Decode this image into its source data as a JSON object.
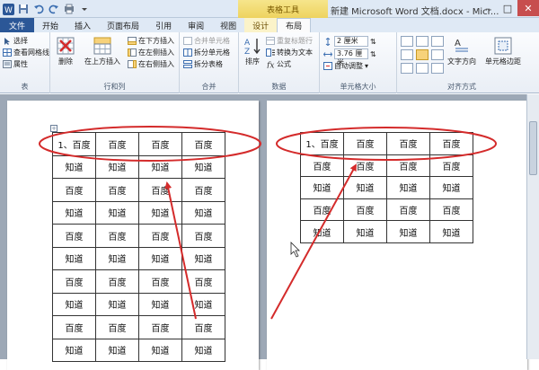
{
  "window": {
    "context_tab_group": "表格工具",
    "document_title": "新建 Microsoft Word 文档.docx - Micr...",
    "minimize": "–",
    "maximize": "□",
    "close": "✕"
  },
  "tabs": [
    {
      "label": "文件"
    },
    {
      "label": "开始"
    },
    {
      "label": "插入"
    },
    {
      "label": "页面布局"
    },
    {
      "label": "引用"
    },
    {
      "label": "审阅"
    },
    {
      "label": "视图"
    },
    {
      "label": "设计"
    },
    {
      "label": "布局"
    }
  ],
  "ribbon": {
    "table_group": {
      "label": "表",
      "select": "选择",
      "gridlines": "查看网格线",
      "properties": "属性"
    },
    "rows_cols_group": {
      "label": "行和列",
      "delete": "删除",
      "insert_above": "在上方插入",
      "insert_below": "在下方插入",
      "insert_left": "在左侧插入",
      "insert_right": "在右侧插入"
    },
    "merge_group": {
      "label": "合并",
      "merge_cells": "合并单元格",
      "split_cells": "拆分单元格",
      "split_table": "拆分表格"
    },
    "data_group": {
      "label": "数据",
      "sort": "排序",
      "repeat_header": "重复标题行",
      "to_text": "转换为文本",
      "formula": "公式"
    },
    "cell_size_group": {
      "label": "单元格大小",
      "height": "2 厘米",
      "width": "3.76 厘米",
      "autofit": "自动调整"
    },
    "alignment_group": {
      "label": "对齐方式",
      "text_direction": "文字方向",
      "cell_margins": "单元格边距"
    }
  },
  "left_table": [
    [
      "1、百度",
      "百度",
      "百度",
      "百度"
    ],
    [
      "知道",
      "知道",
      "知道",
      "知道"
    ],
    [
      "百度",
      "百度",
      "百度",
      "百度"
    ],
    [
      "知道",
      "知道",
      "知道",
      "知道"
    ],
    [
      "百度",
      "百度",
      "百度",
      "百度"
    ],
    [
      "知道",
      "知道",
      "知道",
      "知道"
    ],
    [
      "百度",
      "百度",
      "百度",
      "百度"
    ],
    [
      "知道",
      "知道",
      "知道",
      "知道"
    ],
    [
      "百度",
      "百度",
      "百度",
      "百度"
    ],
    [
      "知道",
      "知道",
      "知道",
      "知道"
    ]
  ],
  "right_table": [
    [
      "1、百度",
      "百度",
      "百度",
      "百度"
    ],
    [
      "百度",
      "百度",
      "百度",
      "百度"
    ],
    [
      "知道",
      "知道",
      "知道",
      "知道"
    ],
    [
      "百度",
      "百度",
      "百度",
      "百度"
    ],
    [
      "知道",
      "知道",
      "知道",
      "知道"
    ]
  ],
  "annotation_color": "#d42b2b"
}
